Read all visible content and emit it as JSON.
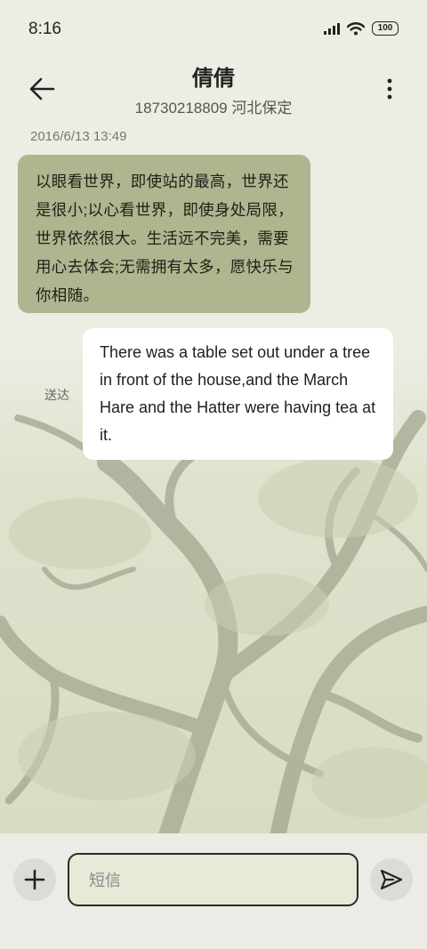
{
  "status_bar": {
    "time": "8:16",
    "battery": "100",
    "icons": [
      "signal-icon",
      "wifi-icon",
      "battery-icon"
    ]
  },
  "header": {
    "contact_name": "倩倩",
    "contact_number": "18730218809 河北保定",
    "back_icon": "back-arrow-icon",
    "more_icon": "more-vertical-icon"
  },
  "conversation": {
    "timestamp": "2016/6/13 13:49",
    "messages": [
      {
        "direction": "incoming",
        "text": "以眼看世界，即使站的最高，世界还是很小;以心看世界，即使身处局限，世界依然很大。生活远不完美，需要用心去体会;无需拥有太多，愿快乐与你相随。"
      },
      {
        "direction": "outgoing",
        "text": "There was a table set out under a tree in front of the house,and the March Hare and the Hatter were having tea at it.",
        "status": "送达"
      }
    ]
  },
  "composer": {
    "placeholder": "短信",
    "add_icon": "plus-icon",
    "send_icon": "send-icon"
  },
  "colors": {
    "background": "#eceee4",
    "incoming_bubble": "#aeb58f",
    "outgoing_bubble": "#ffffff",
    "input_field": "#e6ead6"
  }
}
